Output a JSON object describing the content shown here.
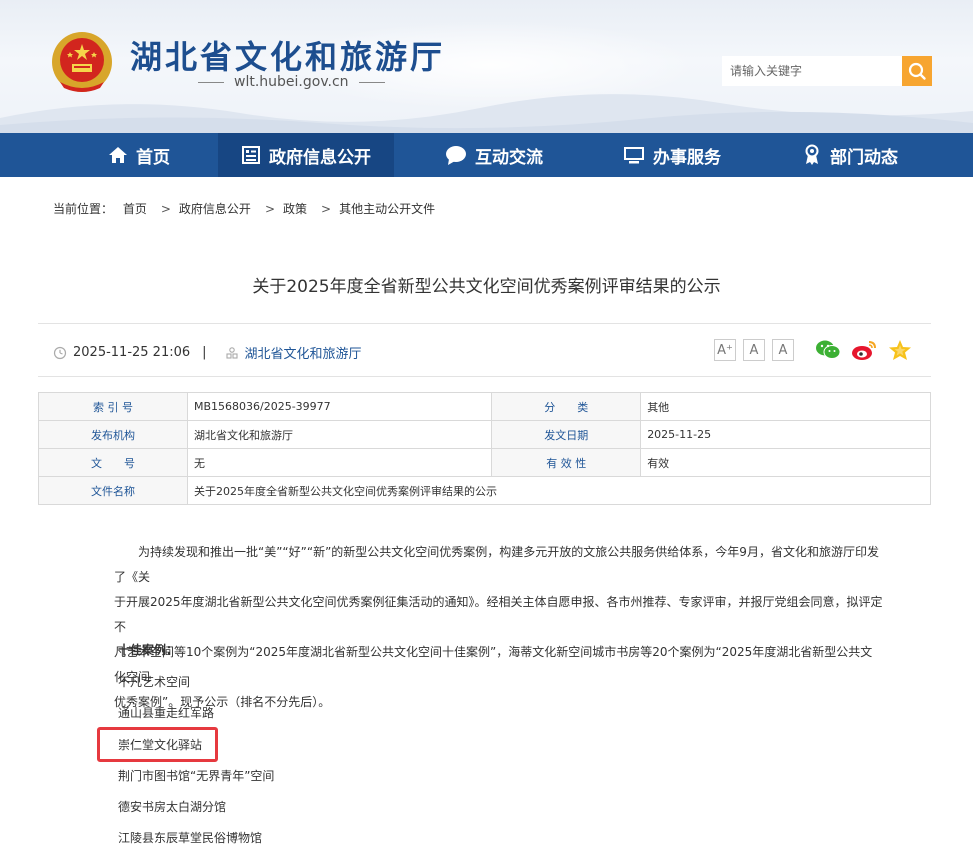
{
  "header": {
    "site_title": "湖北省文化和旅游厅",
    "site_url": "wlt.hubei.gov.cn",
    "search_placeholder": "请输入关键字"
  },
  "nav": {
    "items": [
      {
        "label": "首页",
        "icon": "home-icon"
      },
      {
        "label": "政府信息公开",
        "icon": "document-list-icon"
      },
      {
        "label": "互动交流",
        "icon": "chat-bubble-icon"
      },
      {
        "label": "办事服务",
        "icon": "monitor-icon"
      },
      {
        "label": "部门动态",
        "icon": "medal-icon"
      }
    ],
    "active_index": 1
  },
  "breadcrumb": {
    "prefix": "当前位置：",
    "items": [
      "首页",
      "政府信息公开",
      "政策",
      "其他主动公开文件"
    ],
    "separator": ">"
  },
  "article": {
    "title": "关于2025年度全省新型公共文化空间优秀案例评审结果的公示",
    "datetime": "2025-11-25 21:06",
    "separator": "|",
    "publisher": "湖北省文化和旅游厅",
    "font_buttons": [
      "A⁺",
      "A",
      "A"
    ],
    "share_icons": [
      "wechat-icon",
      "weibo-icon",
      "favorite-star-icon"
    ]
  },
  "info_table": {
    "rows": [
      {
        "label1": "索 引 号",
        "value1": "MB1568036/2025-39977",
        "label2": "分　　类",
        "value2": "其他"
      },
      {
        "label1": "发布机构",
        "value1": "湖北省文化和旅游厅",
        "label2": "发文日期",
        "value2": "2025-11-25"
      },
      {
        "label1": "文　　号",
        "value1": "无",
        "label2": "有 效 性",
        "value2": "有效"
      }
    ],
    "doc_name_label": "文件名称",
    "doc_name_value": "关于2025年度全省新型公共文化空间优秀案例评审结果的公示"
  },
  "content": {
    "lines": [
      "　　为持续发现和推出一批“美”“好”“新”的新型公共文化空间优秀案例，构建多元开放的文旅公共服务供给体系，今年9月，省文化和旅游厅印发了《关",
      "于开展2025年度湖北省新型公共文化空间优秀案例征集活动的通知》。经相关主体自愿申报、各市州推荐、专家评审，并报厅党组会同意，拟评定不",
      "凡艺术空间等10个案例为“2025年度湖北省新型公共文化空间十佳案例”，海蒂文化新空间城市书房等20个案例为“2025年度湖北省新型公共文化空间",
      "优秀案例”。现予公示（排名不分先后）。"
    ],
    "section_heading": "十佳案例：",
    "cases": [
      "不凡艺术空间",
      "通山县重走红军路",
      "崇仁堂文化驿站",
      "荆门市图书馆“无界青年”空间",
      "德安书房太白湖分馆",
      "江陵县东辰草堂民俗博物馆"
    ]
  }
}
